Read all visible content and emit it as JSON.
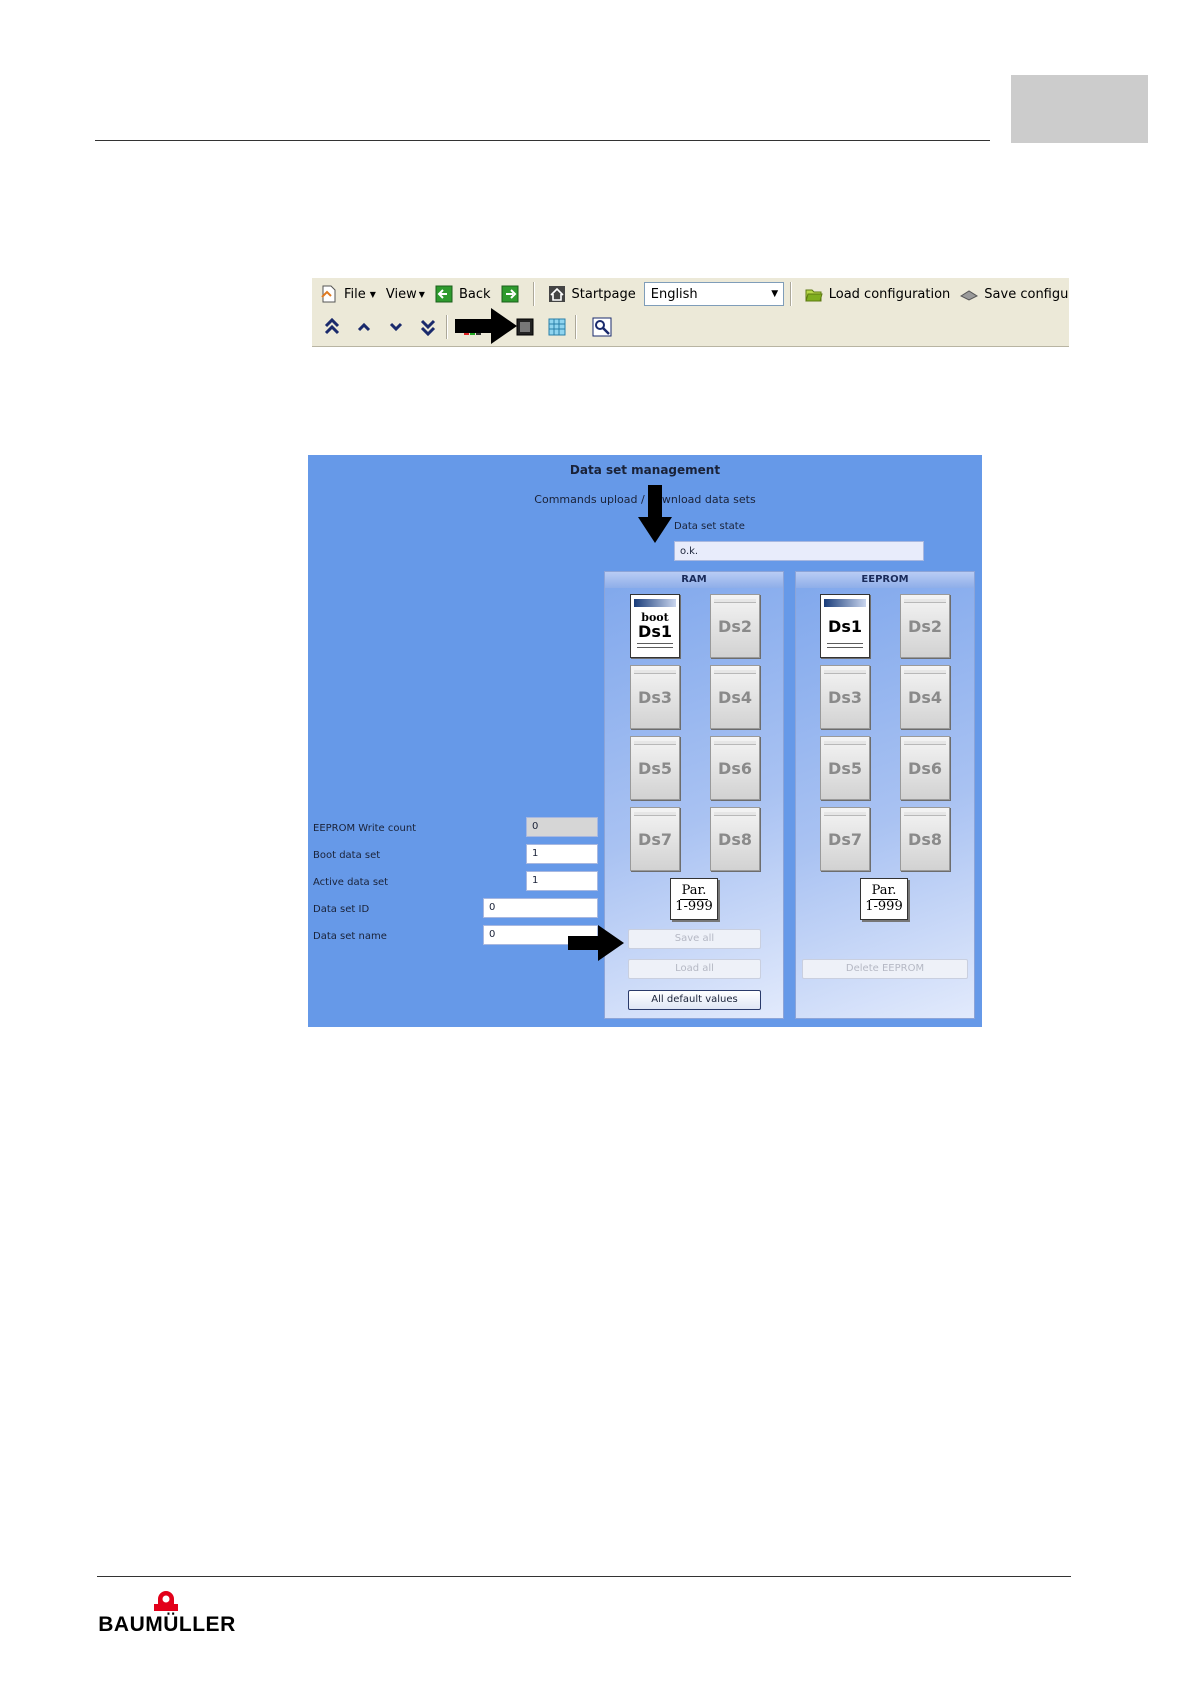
{
  "toolbar": {
    "row1": {
      "file_label": "File",
      "view_label": "View",
      "back_label": "Back",
      "startpage_label": "Startpage",
      "language_value": "English",
      "load_config_label": "Load configuration",
      "save_config_label": "Save configura"
    }
  },
  "dialog": {
    "title": "Data set management",
    "subtitle": "Commands upload / download data sets",
    "state_label": "Data set state",
    "state_value": "o.k.",
    "fields": [
      {
        "label": "EEPROM Write count",
        "value": "0"
      },
      {
        "label": "Boot data set",
        "value": "1"
      },
      {
        "label": "Active data set",
        "value": "1"
      },
      {
        "label": "Data set ID",
        "value": "0"
      },
      {
        "label": "Data set name",
        "value": "0"
      }
    ],
    "ram": {
      "header": "RAM",
      "boot_text": "boot",
      "datasets": [
        "Ds1",
        "Ds2",
        "Ds3",
        "Ds4",
        "Ds5",
        "Ds6",
        "Ds7",
        "Ds8"
      ],
      "par_top": "Par.",
      "par_bottom": "1-999",
      "save_all": "Save all",
      "load_all": "Load all",
      "all_default": "All default values"
    },
    "eeprom": {
      "header": "EEPROM",
      "datasets": [
        "Ds1",
        "Ds2",
        "Ds3",
        "Ds4",
        "Ds5",
        "Ds6",
        "Ds7",
        "Ds8"
      ],
      "par_top": "Par.",
      "par_bottom": "1-999",
      "delete": "Delete EEPROM"
    }
  },
  "footer": {
    "logo_text": "BAUMÜLLER"
  },
  "colors": {
    "app_bg": "#6699e8",
    "toolbar_bg": "#ece9d8",
    "header_box": "#cccccc"
  }
}
